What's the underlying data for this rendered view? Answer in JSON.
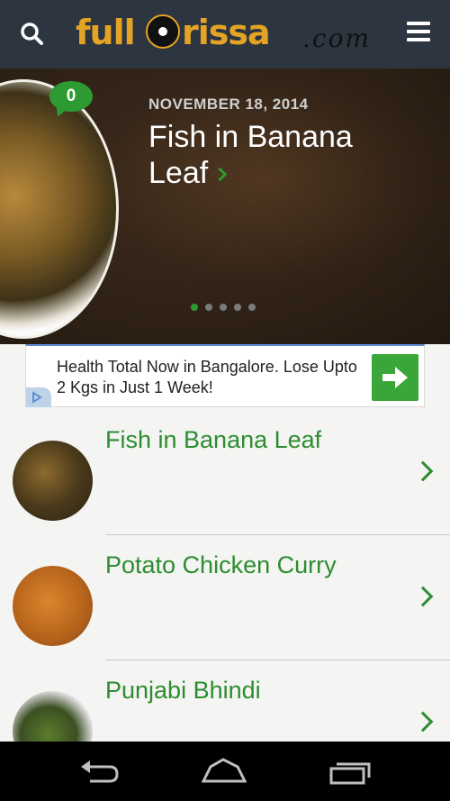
{
  "header": {
    "logo_text": "fullOrissa.com",
    "logo_word": "full",
    "logo_word_2": "rissa",
    "logo_suffix": ".com",
    "search_icon": "search-icon",
    "menu_icon": "hamburger-menu-icon"
  },
  "hero": {
    "comment_count": "0",
    "date": "NOVEMBER 18, 2014",
    "title": "Fish in Banana Leaf",
    "slide_count": 5,
    "active_slide": 1
  },
  "ad": {
    "text": "Health Total Now in Bangalore. Lose Upto 2 Kgs in Just 1 Week!",
    "go_icon": "arrow-right-icon"
  },
  "articles": [
    {
      "title": "Fish in Banana Leaf"
    },
    {
      "title": "Potato Chicken Curry"
    },
    {
      "title": "Punjabi Bhindi"
    }
  ],
  "navbar": {
    "back_icon": "back-icon",
    "home_icon": "home-icon",
    "recents_icon": "recents-icon"
  },
  "colors": {
    "header_bg": "#2d3540",
    "brand": "#e3a324",
    "accent_green": "#2c8d30"
  }
}
